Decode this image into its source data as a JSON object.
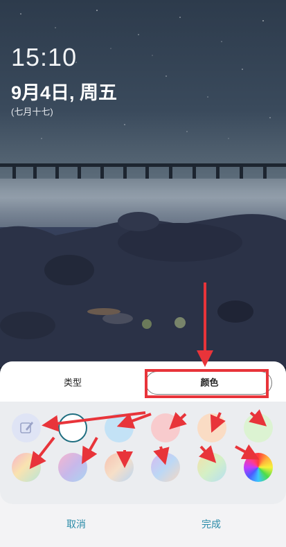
{
  "lockscreen": {
    "time": "15:10",
    "date": "9月4日, 周五",
    "lunar": "(七月十七)"
  },
  "tabs": {
    "type_label": "类型",
    "color_label": "颜色",
    "selected": "color"
  },
  "swatches": [
    {
      "name": "swatch-edit",
      "icon": "pencil-edit-icon",
      "color": "#dde3f4"
    },
    {
      "name": "swatch-none",
      "selected": true,
      "color": "#ffffff"
    },
    {
      "name": "swatch-light-blue",
      "color": "#bfe0f5"
    },
    {
      "name": "swatch-pink",
      "color": "#f7c9cc"
    },
    {
      "name": "swatch-peach",
      "color": "#f9dcc2"
    },
    {
      "name": "swatch-light-green",
      "color": "#d9f2cf"
    },
    {
      "name": "swatch-gradient-1",
      "color": "#f0b8cf"
    },
    {
      "name": "swatch-gradient-2",
      "color": "#c6b8e6"
    },
    {
      "name": "swatch-gradient-3",
      "color": "#f5cdb6"
    },
    {
      "name": "swatch-gradient-4",
      "color": "#bcd0f2"
    },
    {
      "name": "swatch-gradient-5",
      "color": "#d8efc0"
    },
    {
      "name": "swatch-rainbow",
      "color": "#e85050"
    }
  ],
  "actions": {
    "cancel": "取消",
    "done": "完成"
  },
  "annotations_color": "#e8343a"
}
